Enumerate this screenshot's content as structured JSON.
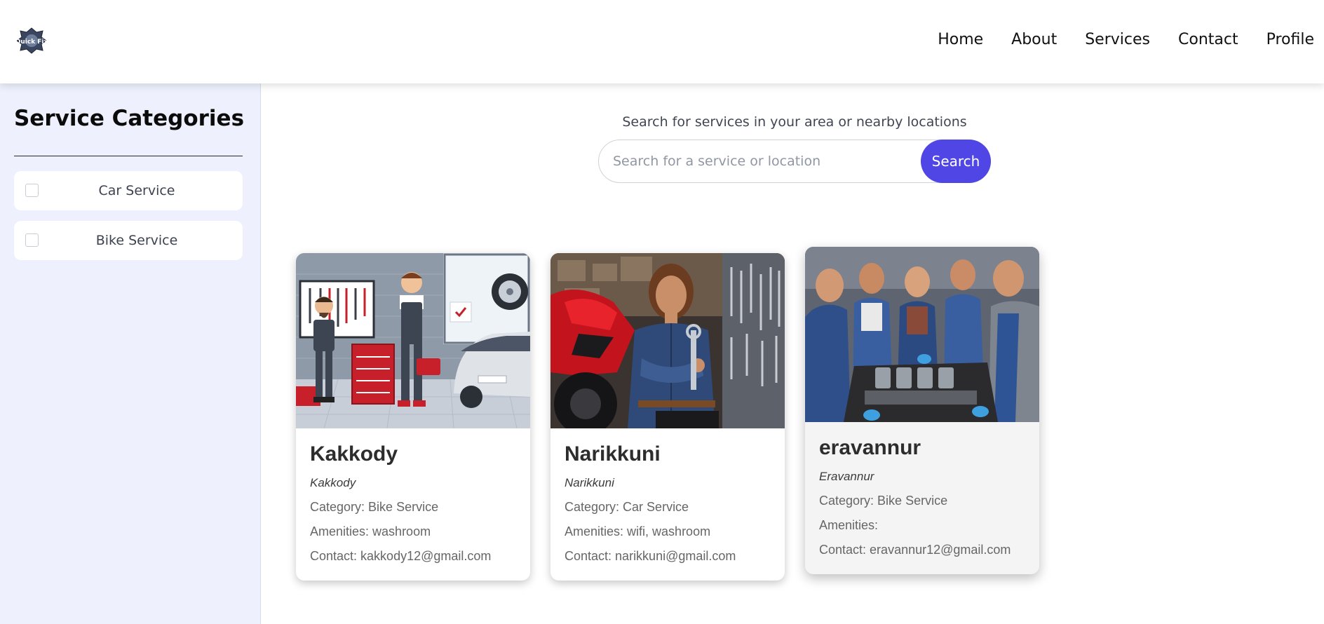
{
  "nav": {
    "logo_text": "Quick Fix",
    "links": [
      "Home",
      "About",
      "Services",
      "Contact",
      "Profile"
    ]
  },
  "sidebar": {
    "title": "Service Categories",
    "categories": [
      {
        "label": "Car Service",
        "checked": false
      },
      {
        "label": "Bike Service",
        "checked": false
      }
    ]
  },
  "search": {
    "caption": "Search for services in your area or nearby locations",
    "placeholder": "Search for a service or location",
    "button_label": "Search"
  },
  "cards": [
    {
      "title": "Kakkody",
      "subtitle": "Kakkody",
      "category_label": "Category: ",
      "category": "Bike Service",
      "amenities_label": "Amenities: ",
      "amenities": "washroom",
      "contact_label": "Contact: ",
      "contact": "kakkody12@gmail.com",
      "image": "cartoon-mechanics-garage-image"
    },
    {
      "title": "Narikkuni",
      "subtitle": "Narikkuni",
      "category_label": "Category: ",
      "category": "Car Service",
      "amenities_label": "Amenities: ",
      "amenities": "wifi, washroom",
      "contact_label": "Contact: ",
      "contact": "narikkuni@gmail.com",
      "image": "mechanic-with-motorbike-image"
    },
    {
      "title": "eravannur",
      "subtitle": "Eravannur",
      "category_label": "Category: ",
      "category": "Bike Service",
      "amenities_label": "Amenities: ",
      "amenities": "",
      "contact_label": "Contact: ",
      "contact": "eravannur12@gmail.com",
      "image": "mechanics-team-engine-image"
    }
  ],
  "colors": {
    "accent": "#4f46e5",
    "sidebar_bg": "#eef1fd"
  }
}
